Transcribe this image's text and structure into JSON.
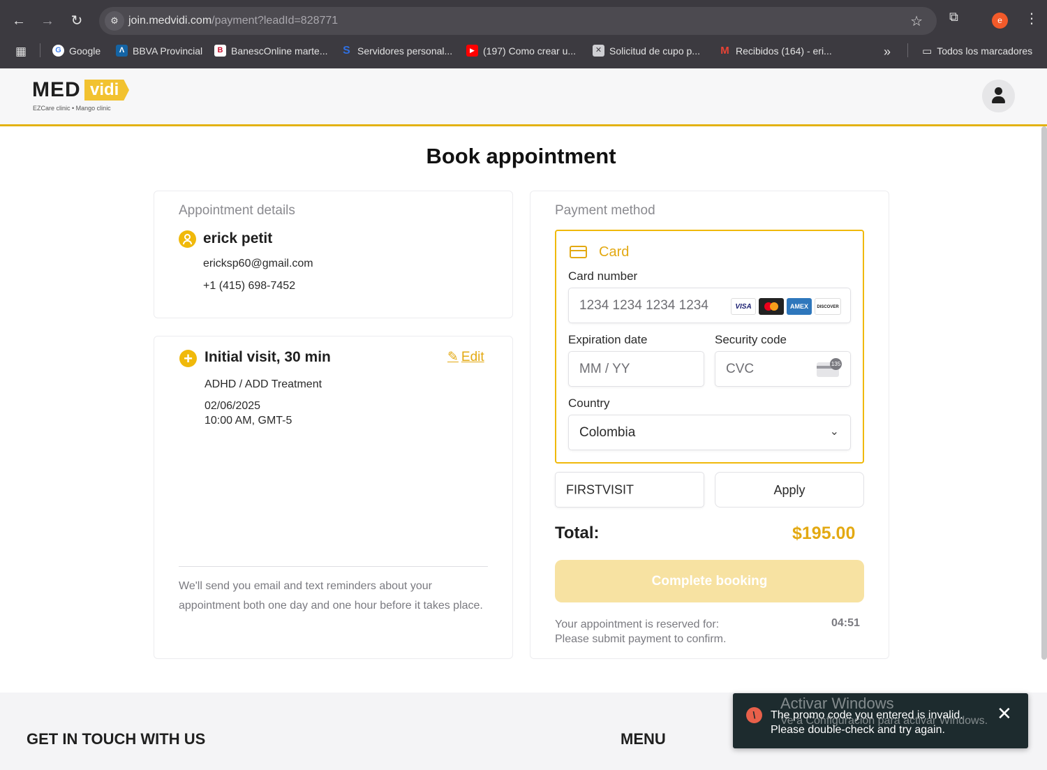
{
  "browser": {
    "url_host": "join.medvidi.com",
    "url_path": "/payment?leadId=828771",
    "profile_initial": "e",
    "bookmarks": [
      {
        "label": "Google"
      },
      {
        "label": "BBVA Provincial"
      },
      {
        "label": "BanescOnline marte..."
      },
      {
        "label": "Servidores personal..."
      },
      {
        "label": "(197) Como crear u..."
      },
      {
        "label": "Solicitud de cupo p..."
      },
      {
        "label": "Recibidos (164) - eri..."
      }
    ],
    "all_bookmarks": "Todos los marcadores"
  },
  "site": {
    "logo_med": "MED",
    "logo_vidi": "vidi",
    "logo_sub": "EZCare clinic • Mango clinic"
  },
  "page": {
    "title": "Book appointment"
  },
  "appointment": {
    "section_title": "Appointment details",
    "name": "erick petit",
    "email": "ericksp60@gmail.com",
    "phone": "+1 (415) 698-7452",
    "visit_title": "Initial visit, 30 min",
    "edit_label": "Edit",
    "treatment": "ADHD / ADD Treatment",
    "date": "02/06/2025",
    "time": "10:00 AM, GMT-5",
    "reminder": "We'll send you email and text reminders about your appointment both one day and one hour before it takes place."
  },
  "payment": {
    "section_title": "Payment method",
    "card_label": "Card",
    "card_number_label": "Card number",
    "card_number_placeholder": "1234 1234 1234 1234",
    "card_brands": [
      "VISA",
      "MC",
      "AMEX",
      "DISCOVER"
    ],
    "expiration_label": "Expiration date",
    "expiration_placeholder": "MM / YY",
    "security_label": "Security code",
    "security_placeholder": "CVC",
    "cvc_hint": "135",
    "country_label": "Country",
    "country_value": "Colombia",
    "promo_value": "FIRSTVISIT",
    "apply_label": "Apply",
    "total_label": "Total:",
    "total_value": "$195.00",
    "complete_label": "Complete booking",
    "reserve_line1": "Your appointment is reserved for:",
    "reserve_line2": "Please submit payment to confirm.",
    "timer": "04:51"
  },
  "footer": {
    "contact_heading": "GET IN TOUCH WITH US",
    "menu_heading": "MENU"
  },
  "toast": {
    "line1": "The promo code you entered is invalid.",
    "line2": "Please double-check and try again."
  },
  "watermark": {
    "line1": "Activar Windows",
    "line2": "Ve a Configuración para activar Windows."
  },
  "colors": {
    "accent": "#f0b90b",
    "accent_text": "#e3a912",
    "toast_bg": "#1d2b2e",
    "error": "#e8604a"
  }
}
